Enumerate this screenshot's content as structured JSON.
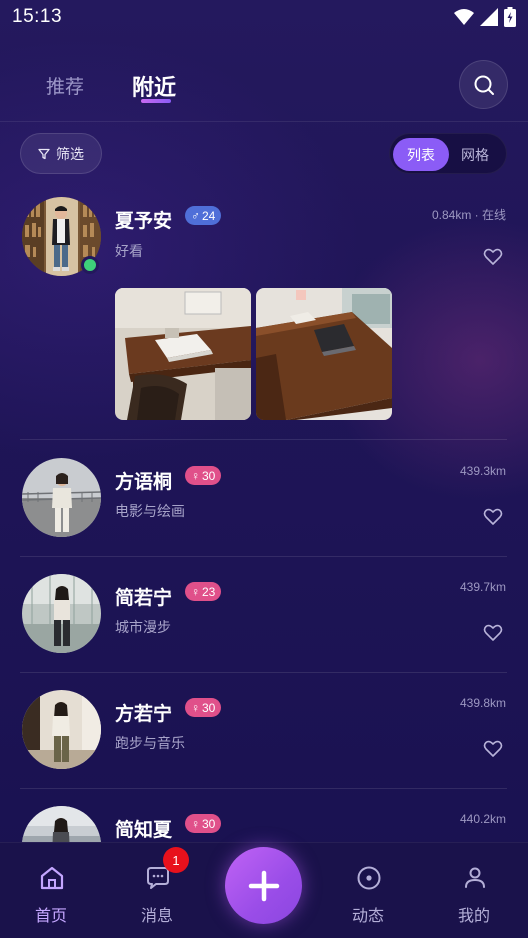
{
  "status_bar": {
    "time": "15:13"
  },
  "header": {
    "tabs": [
      {
        "label": "推荐",
        "active": false
      },
      {
        "label": "附近",
        "active": true
      }
    ],
    "search_icon": "search-icon"
  },
  "toolbar": {
    "filter_label": "筛选",
    "filter_icon": "filter-icon",
    "view_options": [
      {
        "label": "列表",
        "active": true
      },
      {
        "label": "网格",
        "active": false
      }
    ]
  },
  "users": [
    {
      "name": "夏予安",
      "gender": "♂",
      "age": "24",
      "bio": "好看",
      "distance": "0.84km · 在线",
      "online": true,
      "photos": 2
    },
    {
      "name": "方语桐",
      "gender": "♀",
      "age": "30",
      "bio": "电影与绘画",
      "distance": "439.3km",
      "online": false
    },
    {
      "name": "简若宁",
      "gender": "♀",
      "age": "23",
      "bio": "城市漫步",
      "distance": "439.7km",
      "online": false
    },
    {
      "name": "方若宁",
      "gender": "♀",
      "age": "30",
      "bio": "跑步与音乐",
      "distance": "439.8km",
      "online": false
    },
    {
      "name": "简知夏",
      "gender": "♀",
      "age": "30",
      "bio": "",
      "distance": "440.2km",
      "online": false
    }
  ],
  "bottom_nav": {
    "items": [
      {
        "label": "首页",
        "icon": "home-icon",
        "active": true
      },
      {
        "label": "消息",
        "icon": "message-icon",
        "active": false,
        "badge": "1"
      },
      {
        "label": "动态",
        "icon": "moments-icon",
        "active": false
      },
      {
        "label": "我的",
        "icon": "profile-icon",
        "active": false
      }
    ],
    "fab_icon": "plus-icon"
  },
  "colors": {
    "accent": "#8b5cf6",
    "male_badge": "#4f6fd8",
    "female_badge": "#e0508a",
    "online": "#3ed07a",
    "notification": "#e8111c"
  }
}
